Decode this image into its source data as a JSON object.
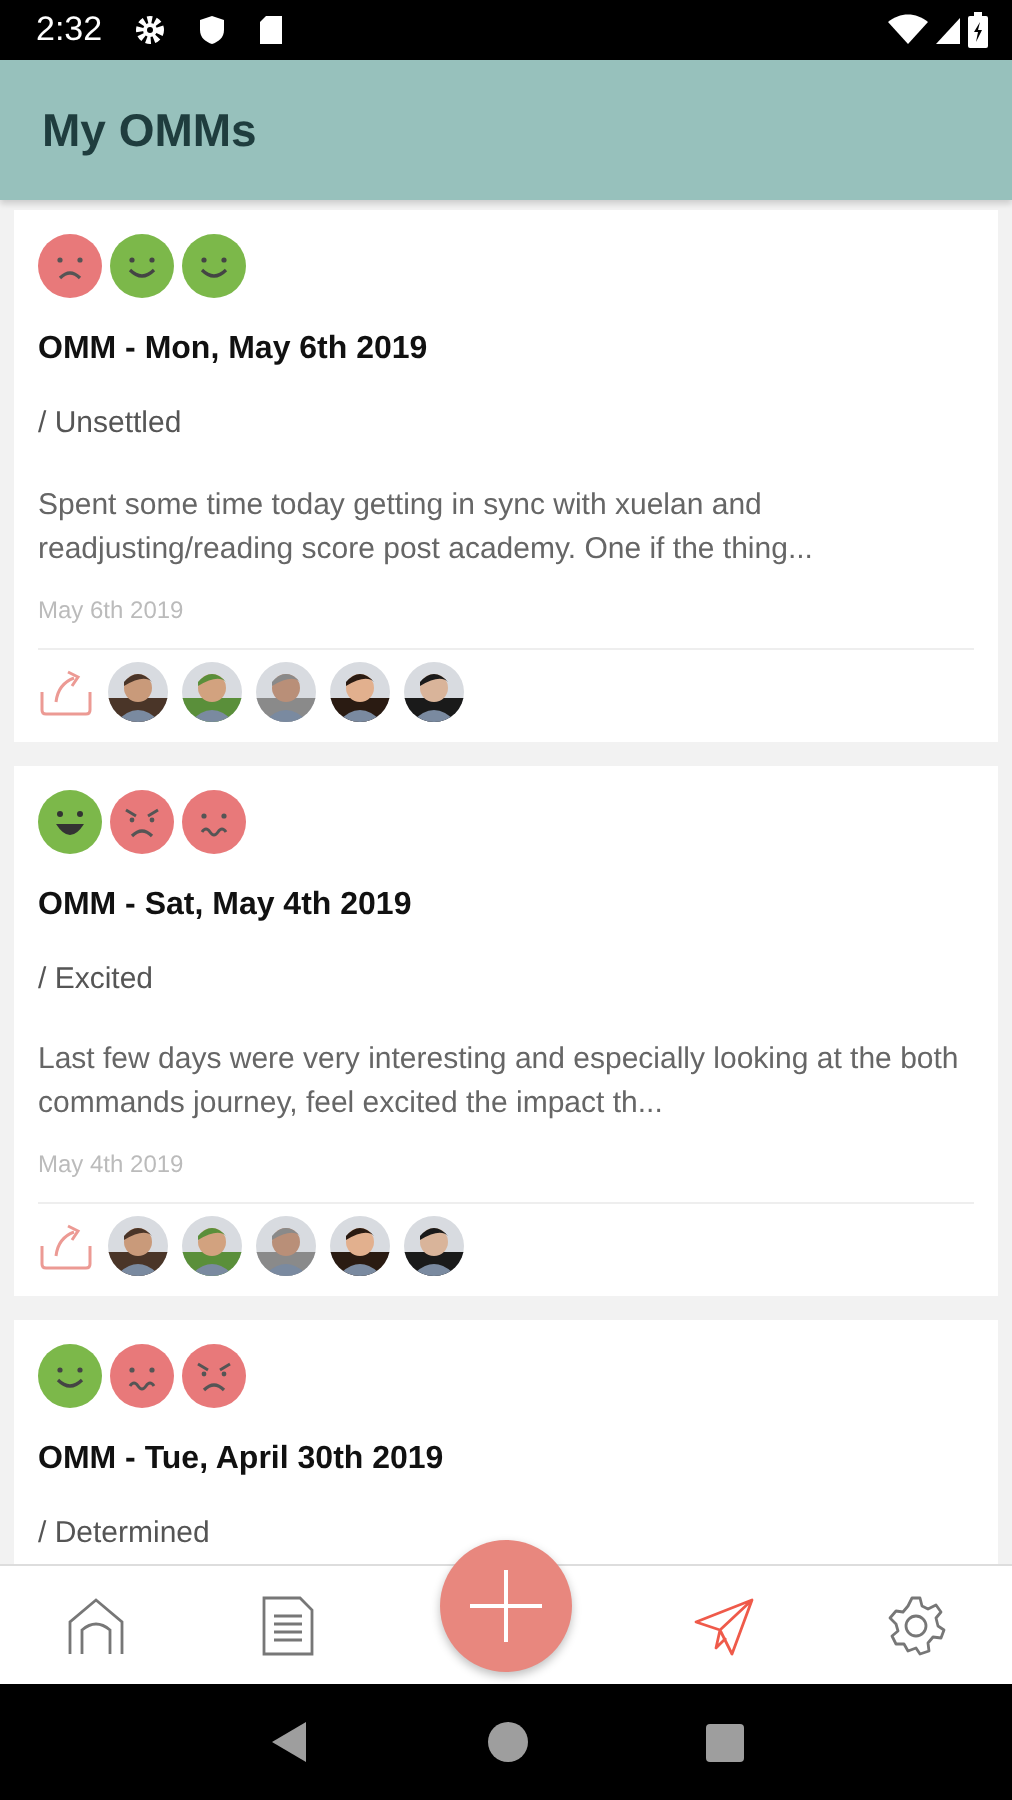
{
  "status_bar": {
    "time": "2:32"
  },
  "header": {
    "title": "My OMMs"
  },
  "omms": [
    {
      "moods": [
        {
          "kind": "sad",
          "color": "#e8797a"
        },
        {
          "kind": "smile",
          "color": "#7cb84a"
        },
        {
          "kind": "smile",
          "color": "#7cb84a"
        }
      ],
      "title": "OMM - Mon, May 6th 2019",
      "feeling": "/ Unsettled",
      "body": "Spent some time today getting in sync with xuelan and readjusting/reading score post academy. One if the thing...",
      "date": "May 6th 2019"
    },
    {
      "moods": [
        {
          "kind": "grin",
          "color": "#7cb84a"
        },
        {
          "kind": "angry",
          "color": "#e8797a"
        },
        {
          "kind": "worried",
          "color": "#e8797a"
        }
      ],
      "title": "OMM - Sat, May 4th 2019",
      "feeling": "/ Excited",
      "body": "Last few days were very interesting and especially looking at the both commands journey, feel excited the impact th...",
      "date": "May 4th 2019"
    },
    {
      "moods": [
        {
          "kind": "smile",
          "color": "#7cb84a"
        },
        {
          "kind": "worried",
          "color": "#e8797a"
        },
        {
          "kind": "angry",
          "color": "#e8797a"
        }
      ],
      "title": "OMM - Tue, April 30th 2019",
      "feeling": "/ Determined"
    }
  ],
  "nav": [
    {
      "kind": "home",
      "selected": false
    },
    {
      "kind": "document",
      "selected": false
    },
    {
      "kind": "add",
      "selected": false
    },
    {
      "kind": "send",
      "selected": true
    },
    {
      "kind": "settings",
      "selected": false
    }
  ]
}
